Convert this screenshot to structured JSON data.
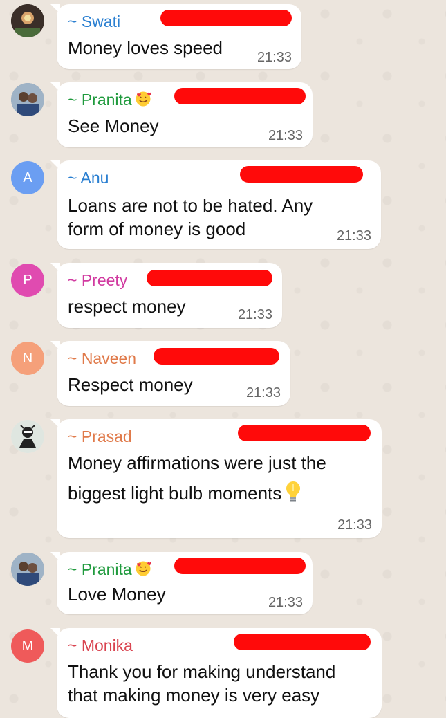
{
  "messages": [
    {
      "sender": "~ Swati",
      "text": [
        "Money loves speed"
      ],
      "time": "21:33",
      "avatar": "photo",
      "color": "#2a7fd1"
    },
    {
      "sender": "~ Pranita",
      "text": [
        "See Money"
      ],
      "time": "21:33",
      "avatar": "photo",
      "color": "#1f9a3d",
      "emoji": "smiling-face-with-hearts"
    },
    {
      "sender": "~ Anu",
      "text": [
        "Loans are not to be hated. Any",
        "form of money is good"
      ],
      "time": "21:33",
      "avatar": "A",
      "avatar_color": "#6b9ef2",
      "color": "#2a7fd1"
    },
    {
      "sender": "~ Preety",
      "text": [
        "respect money"
      ],
      "time": "21:33",
      "avatar": "P",
      "avatar_color": "#e04bb0",
      "color": "#d13aa0"
    },
    {
      "sender": "~ Naveen",
      "text": [
        "Respect money"
      ],
      "time": "21:33",
      "avatar": "N",
      "avatar_color": "#f5a07a",
      "color": "#e07a4a"
    },
    {
      "sender": "~ Prasad",
      "text": [
        "Money affirmations were just   the",
        "biggest light bulb moments"
      ],
      "time": "21:33",
      "avatar": "sticker",
      "color": "#e07a4a",
      "emoji": "light-bulb"
    },
    {
      "sender": "~ Pranita",
      "text": [
        "Love Money"
      ],
      "time": "21:33",
      "avatar": "photo",
      "color": "#1f9a3d",
      "emoji": "smiling-face-with-hearts"
    },
    {
      "sender": "~ Monika",
      "text": [
        "Thank you for making understand",
        "that making money is very easy"
      ],
      "time": "",
      "avatar": "M",
      "avatar_color": "#ef5a5a",
      "color": "#d9434f"
    }
  ],
  "colors": {
    "background": "#ece5dd",
    "bubble": "#ffffff",
    "redaction": "#ff0a0a",
    "timestamp": "#666666"
  }
}
